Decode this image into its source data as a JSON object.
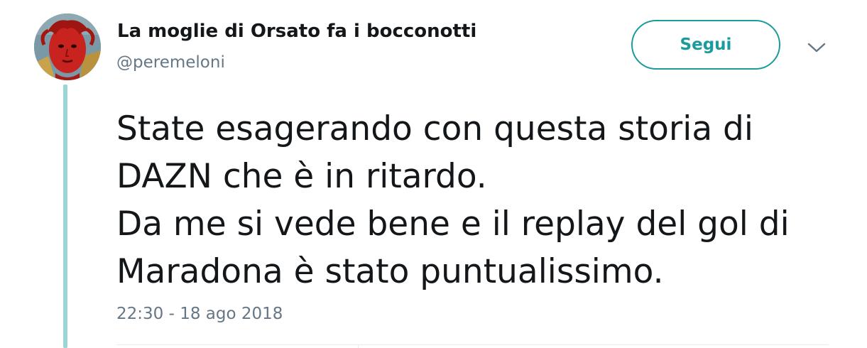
{
  "tweet": {
    "author": {
      "display_name": "La moglie di Orsato fa i bocconotti",
      "screen_name": "@peremeloni"
    },
    "follow_label": "Segui",
    "text_lines": [
      "State esagerando con questa storia di",
      "DAZN che è in ritardo.",
      "Da me si vede bene e il replay del gol di",
      "Maradona è stato puntualissimo."
    ],
    "timestamp": "22:30 - 18 ago 2018"
  },
  "colors": {
    "accent": "#1b9b9b",
    "thread_line": "#9bd5d8",
    "secondary_text": "#657786",
    "primary_text": "#14171a"
  },
  "icons": {
    "menu": "chevron-down-icon",
    "avatar": "red-medusa-portrait"
  }
}
